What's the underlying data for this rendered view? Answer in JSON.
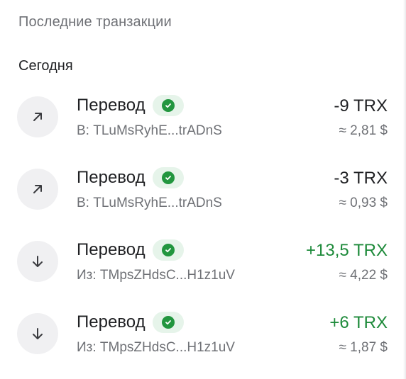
{
  "section_title": "Последние транзакции",
  "group_title": "Сегодня",
  "colors": {
    "positive": "#1d8a3a",
    "neutral": "#1f2023",
    "status": "#22963f"
  },
  "transactions": [
    {
      "title": "Перевод",
      "direction": "out",
      "icon": "arrow-up-right-icon",
      "status_icon": "check-circle-icon",
      "address": "В: TLuMsRyhE...trADnS",
      "amount": "-9 TRX",
      "fiat": "≈ 2,81 $"
    },
    {
      "title": "Перевод",
      "direction": "out",
      "icon": "arrow-up-right-icon",
      "status_icon": "check-circle-icon",
      "address": "В: TLuMsRyhE...trADnS",
      "amount": "-3 TRX",
      "fiat": "≈ 0,93 $"
    },
    {
      "title": "Перевод",
      "direction": "in",
      "icon": "arrow-down-icon",
      "status_icon": "check-circle-icon",
      "address": "Из: TMpsZHdsC...H1z1uV",
      "amount": "+13,5 TRX",
      "fiat": "≈ 4,22 $"
    },
    {
      "title": "Перевод",
      "direction": "in",
      "icon": "arrow-down-icon",
      "status_icon": "check-circle-icon",
      "address": "Из: TMpsZHdsC...H1z1uV",
      "amount": "+6 TRX",
      "fiat": "≈ 1,87 $"
    }
  ]
}
